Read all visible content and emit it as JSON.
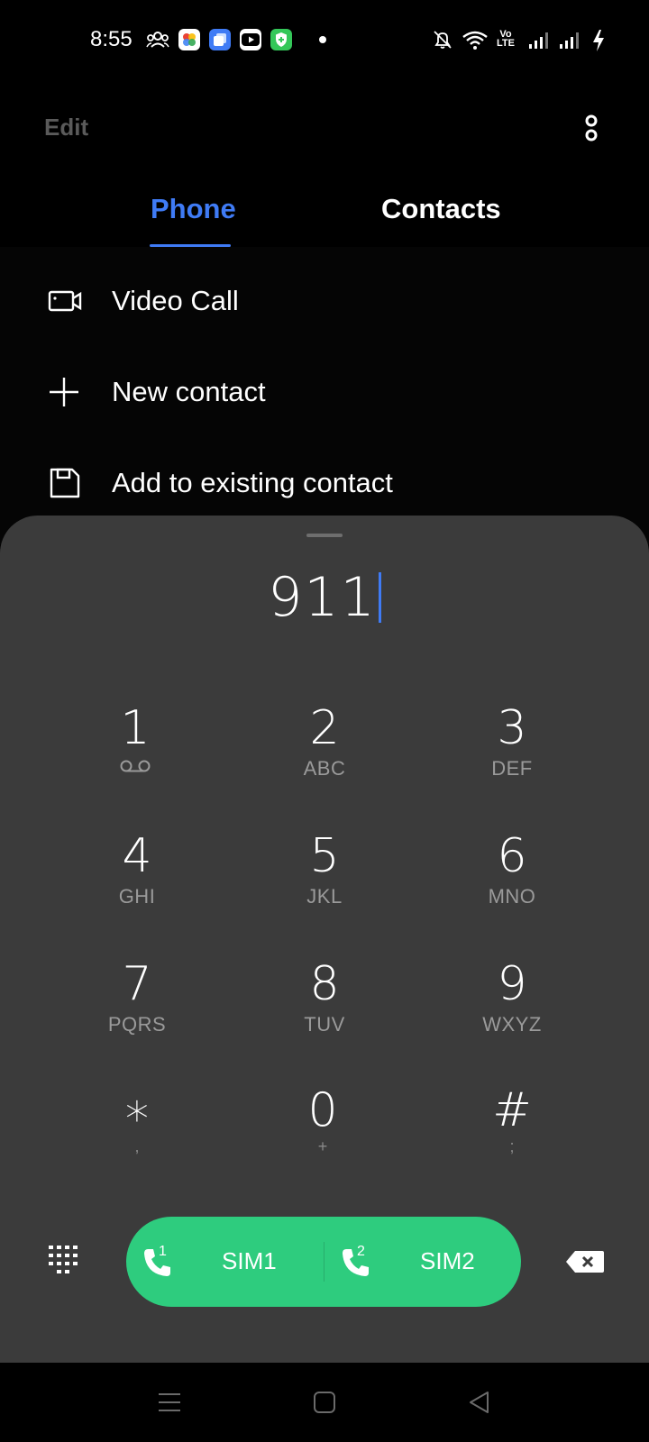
{
  "status_bar": {
    "time": "8:55",
    "icons": [
      "group-icon",
      "photos-app-icon",
      "tabs-app-icon",
      "youtube-icon",
      "shield-app-icon",
      "notification-dot",
      "mute-icon",
      "wifi-icon",
      "volte-icon",
      "signal-icon",
      "signal-icon",
      "charging-icon"
    ],
    "volte_label": "Vo LTE"
  },
  "header": {
    "edit_label": "Edit",
    "more_icon": "more-vertical-icon"
  },
  "tabs": [
    {
      "label": "Phone",
      "active": true
    },
    {
      "label": "Contacts",
      "active": false
    }
  ],
  "options": [
    {
      "label": "Video Call",
      "icon": "video-call-icon"
    },
    {
      "label": "New contact",
      "icon": "plus-icon"
    },
    {
      "label": "Add to existing contact",
      "icon": "save-icon"
    }
  ],
  "dialer": {
    "number": "911",
    "keys": [
      {
        "digit": "1",
        "sub": "voicemail"
      },
      {
        "digit": "2",
        "sub": "ABC"
      },
      {
        "digit": "3",
        "sub": "DEF"
      },
      {
        "digit": "4",
        "sub": "GHI"
      },
      {
        "digit": "5",
        "sub": "JKL"
      },
      {
        "digit": "6",
        "sub": "MNO"
      },
      {
        "digit": "7",
        "sub": "PQRS"
      },
      {
        "digit": "8",
        "sub": "TUV"
      },
      {
        "digit": "9",
        "sub": "WXYZ"
      },
      {
        "digit": "∗",
        "sub": ","
      },
      {
        "digit": "0",
        "sub": "+"
      },
      {
        "digit": "#",
        "sub": ";"
      }
    ],
    "sim1_label": "SIM1",
    "sim1_num": "1",
    "sim2_label": "SIM2",
    "sim2_num": "2"
  },
  "colors": {
    "accent": "#3f7bf5",
    "call_green": "#2ecc7e",
    "sheet_bg": "#3b3b3b"
  }
}
